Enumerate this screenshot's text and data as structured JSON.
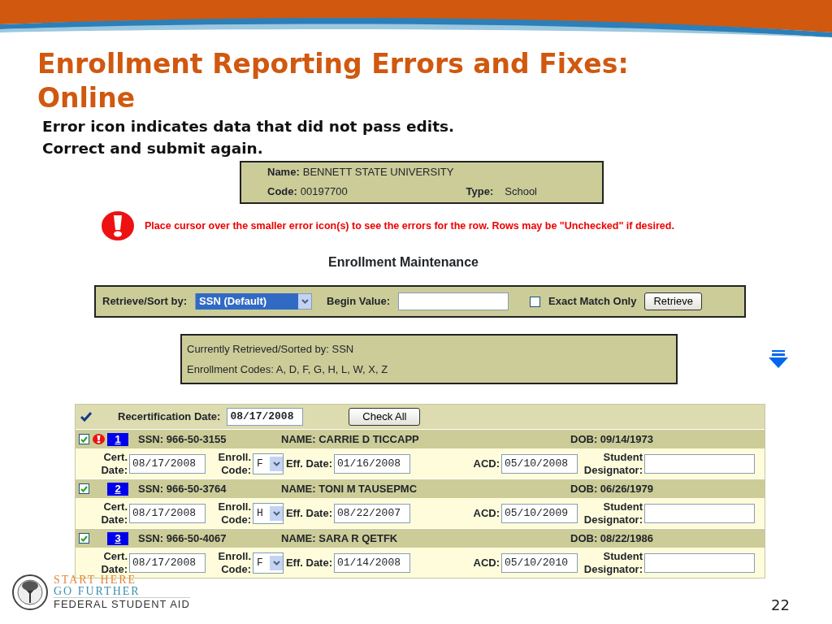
{
  "slide": {
    "title": "Enrollment Reporting Errors and Fixes: Online",
    "subtitle": [
      "Error icon indicates data that did not pass edits.",
      "Correct and submit again."
    ],
    "page_number": "22"
  },
  "school": {
    "name_label": "Name:",
    "name": "BENNETT STATE UNIVERSITY",
    "code_label": "Code:",
    "code": "00197700",
    "type_label": "Type:",
    "type": "School"
  },
  "alert": {
    "message": "Place cursor over the smaller error icon(s) to see the errors for the row. Rows may be \"Unchecked\" if desired."
  },
  "section_title": "Enrollment Maintenance",
  "retrieve": {
    "sort_label": "Retrieve/Sort by:",
    "sort_value": "SSN (Default)",
    "begin_label": "Begin Value:",
    "exact_match_label": "Exact Match Only",
    "exact_match_checked": false,
    "button": "Retrieve"
  },
  "info": [
    "Currently Retrieved/Sorted by: SSN",
    "Enrollment Codes: A, D, F, G, H, L, W, X, Z"
  ],
  "table": {
    "recert_label": "Recertification Date:",
    "recert_value": "08/17/2008",
    "check_all_button": "Check All",
    "rows": [
      {
        "checked": true,
        "error": true,
        "number": "1",
        "ssn": "SSN: 966-50-3155",
        "name": "NAME: CARRIE D TICCAPP",
        "dob": "DOB: 09/14/1973",
        "fields": [
          {
            "kind": "text",
            "label": "Cert. Date:",
            "value": "08/17/2008"
          },
          {
            "kind": "select",
            "label": "Enroll. Code:",
            "value": "F"
          },
          {
            "kind": "text",
            "label": "Eff. Date:",
            "value": "01/16/2008"
          },
          {
            "kind": "text",
            "label": "ACD:",
            "value": "05/10/2008"
          },
          {
            "kind": "text",
            "label": "Student Designator:"
          }
        ]
      },
      {
        "checked": true,
        "error": false,
        "number": "2",
        "ssn": "SSN: 966-50-3764",
        "name": "NAME: TONI M TAUSEPMC",
        "dob": "DOB: 06/26/1979",
        "fields": [
          {
            "kind": "text",
            "label": "Cert. Date:",
            "value": "08/17/2008"
          },
          {
            "kind": "select",
            "label": "Enroll. Code:",
            "value": "H"
          },
          {
            "kind": "text",
            "label": "Eff. Date:",
            "value": "08/22/2007"
          },
          {
            "kind": "text",
            "label": "ACD:",
            "value": "05/10/2009"
          },
          {
            "kind": "text",
            "label": "Student Designator:"
          }
        ]
      },
      {
        "checked": true,
        "error": false,
        "number": "3",
        "ssn": "SSN: 966-50-4067",
        "name": "NAME: SARA R QETFK",
        "dob": "DOB: 08/22/1986",
        "fields": [
          {
            "kind": "text",
            "label": "Cert. Date:",
            "value": "08/17/2008"
          },
          {
            "kind": "select",
            "label": "Enroll. Code:",
            "value": "F"
          },
          {
            "kind": "text",
            "label": "Eff. Date:",
            "value": "01/14/2008"
          },
          {
            "kind": "text",
            "label": "ACD:",
            "value": "05/10/2010"
          },
          {
            "kind": "text",
            "label": "Student Designator:"
          }
        ]
      }
    ]
  },
  "logo": {
    "lines": [
      "START HERE",
      "GO FURTHER",
      "FEDERAL STUDENT AID"
    ]
  }
}
